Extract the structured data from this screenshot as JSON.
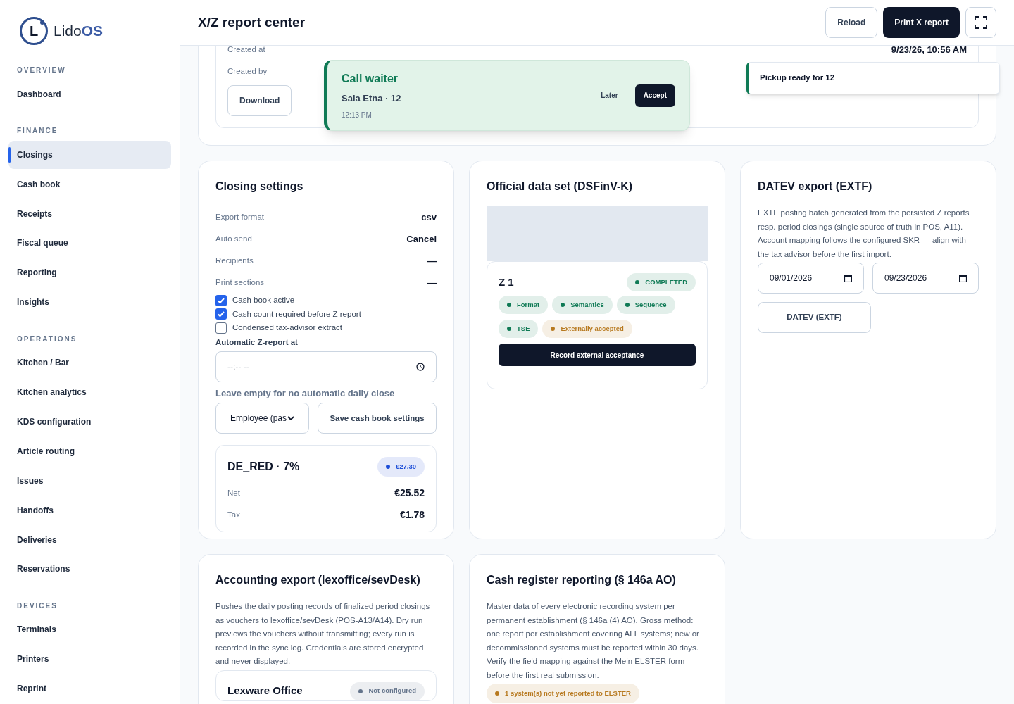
{
  "brand": {
    "mark": "L",
    "name_light": "Lido",
    "name_bold": "OS"
  },
  "sidebar": {
    "sections": [
      {
        "heading": "OVERVIEW",
        "items": [
          {
            "label": "Dashboard",
            "selected": false
          }
        ]
      },
      {
        "heading": "FINANCE",
        "items": [
          {
            "label": "Closings",
            "selected": true
          },
          {
            "label": "Cash book",
            "selected": false
          },
          {
            "label": "Receipts",
            "selected": false
          },
          {
            "label": "Fiscal queue",
            "selected": false
          },
          {
            "label": "Reporting",
            "selected": false
          },
          {
            "label": "Insights",
            "selected": false
          }
        ]
      },
      {
        "heading": "OPERATIONS",
        "items": [
          {
            "label": "Kitchen / Bar",
            "selected": false
          },
          {
            "label": "Kitchen analytics",
            "selected": false
          },
          {
            "label": "KDS configuration",
            "selected": false
          },
          {
            "label": "Article routing",
            "selected": false
          },
          {
            "label": "Issues",
            "selected": false
          },
          {
            "label": "Handoffs",
            "selected": false
          },
          {
            "label": "Deliveries",
            "selected": false
          },
          {
            "label": "Reservations",
            "selected": false
          }
        ]
      },
      {
        "heading": "DEVICES",
        "items": [
          {
            "label": "Terminals",
            "selected": false
          },
          {
            "label": "Printers",
            "selected": false
          },
          {
            "label": "Reprint",
            "selected": false
          }
        ]
      }
    ]
  },
  "header": {
    "title": "X/Z report center",
    "buttons": [
      {
        "kind": "outline",
        "label": "Reload"
      },
      {
        "kind": "primary",
        "label": "Print X report"
      },
      {
        "kind": "fullscreen"
      }
    ]
  },
  "report": {
    "rows": [
      {
        "label": "Created at",
        "value": "9/23/26, 10:56 AM"
      },
      {
        "label": "Created by"
      }
    ],
    "button": "Download"
  },
  "toasts": [
    {
      "kind": "call",
      "title": "Call waiter",
      "subtitle": "Sala Etna · 12",
      "time": "12:13 PM",
      "later": "Later",
      "accept": "Accept"
    },
    {
      "kind": "info",
      "title": "Pickup ready for 12"
    }
  ],
  "closing_settings": {
    "title": "Closing settings",
    "fields": [
      {
        "label": "Export format",
        "value": "csv"
      },
      {
        "label": "Auto send",
        "value": "Cancel"
      },
      {
        "label": "Recipients",
        "value": "—"
      },
      {
        "label": "Print sections",
        "value": "—"
      }
    ],
    "checkboxes": [
      {
        "label": "Cash book active",
        "checked": true
      },
      {
        "label": "Cash count required before Z report",
        "checked": true
      },
      {
        "label": "Condensed tax-advisor extract",
        "checked": false
      }
    ],
    "time_label": "Automatic Z-report at",
    "time_placeholder": "--:-- --",
    "hint": "Leave empty for no automatic daily close",
    "select_value": "Employee (pas",
    "save_button": "Save cash book settings",
    "tax": {
      "title": "DE_RED · 7%",
      "badge": {
        "label": "€27.30",
        "color": "#1d4ed8"
      },
      "rows": [
        {
          "label": "Net",
          "value": "€25.52"
        },
        {
          "label": "Tax",
          "value": "€1.78"
        }
      ]
    }
  },
  "dsfinvk": {
    "title": "Official data set (DSFinV-K)",
    "closing": {
      "title": "Z 1",
      "status": {
        "label": "COMPLETED",
        "color": "#0f7a55"
      },
      "checks": [
        {
          "label": "Format",
          "color": "#0f7a55"
        },
        {
          "label": "Semantics",
          "color": "#0f7a55"
        },
        {
          "label": "Sequence",
          "color": "#0f7a55"
        },
        {
          "label": "TSE",
          "color": "#0f7a55"
        },
        {
          "label": "Externally accepted",
          "color": "#b7791f"
        }
      ],
      "button": "Record external acceptance"
    }
  },
  "datev": {
    "title": "DATEV export (EXTF)",
    "description": "EXTF posting batch generated from the persisted Z reports resp. period closings (single source of truth in POS, A11). Account mapping follows the configured SKR — align with the tax advisor before the first import.",
    "dates": [
      "09/01/2026",
      "09/23/2026"
    ],
    "button": "DATEV (EXTF)"
  },
  "accounting": {
    "title": "Accounting export (lexoffice/sevDesk)",
    "description": "Pushes the daily posting records of finalized period closings as vouchers to lexoffice/sevDesk (POS-A13/A14). Dry run previews the vouchers without transmitting; every run is recorded in the sync log. Credentials are stored encrypted and never displayed.",
    "provider": {
      "title": "Lexware Office",
      "badge": {
        "label": "Not configured",
        "color": "#64748b"
      }
    }
  },
  "reporting": {
    "title": "Cash register reporting (§ 146a AO)",
    "description": "Master data of every electronic recording system per permanent establishment (§ 146a (4) AO). Gross method: one report per establishment covering ALL systems; new or decommissioned systems must be reported within 30 days. Verify the field mapping against the Mein ELSTER form before the first real submission.",
    "badge": {
      "label": "1 system(s) not yet reported to ELSTER",
      "color": "#b7791f"
    }
  }
}
